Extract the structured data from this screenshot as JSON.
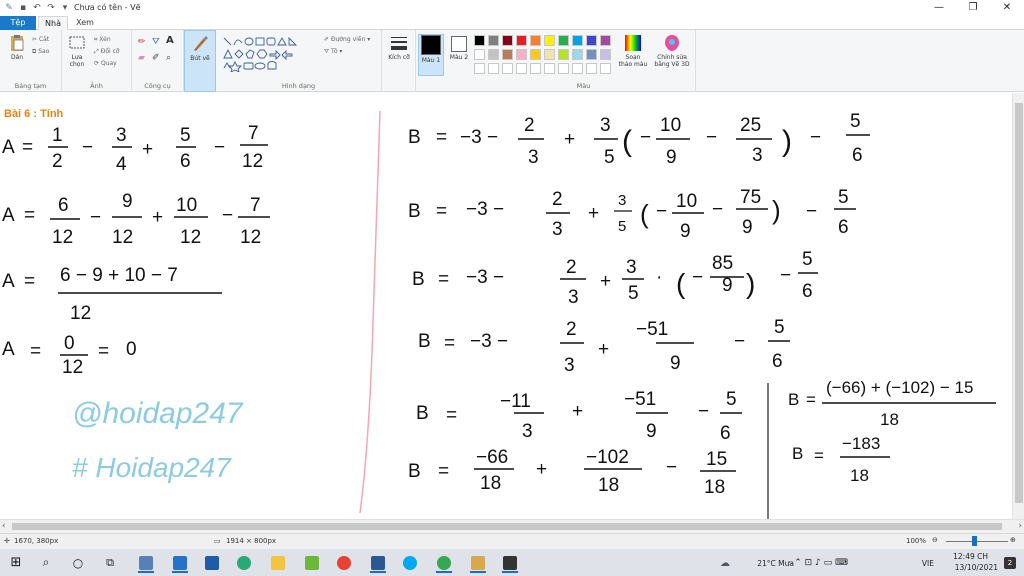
{
  "window": {
    "title": "Chưa có tên - Vẽ",
    "min": "—",
    "max": "❐",
    "close": "✕"
  },
  "tabs": [
    "Tệp",
    "Nhà",
    "Xem"
  ],
  "ribbon": {
    "groups": {
      "clipboard": "Bảng tạm",
      "image": "Ảnh",
      "tools": "Công cụ",
      "shapes": "Hình dạng",
      "colors": "Màu"
    },
    "paste": "Dán",
    "cut": "Cắt",
    "copy": "Sao",
    "select": "Lựa chọn",
    "crop": "Xén",
    "resize": "Đổi cỡ",
    "rotate": "Quay",
    "brush": "Bút vẽ",
    "outline": "Đường viền",
    "fill": "Tô",
    "size": "Kích cỡ",
    "color1": "Màu 1",
    "color2": "Màu 2",
    "edit_colors": "Soạn thảo màu",
    "paint3d": "Chỉnh sửa bằng Vẽ 3D",
    "palette": [
      "#000000",
      "#7f7f7f",
      "#880015",
      "#ed1c24",
      "#ff7f27",
      "#fff200",
      "#22b14c",
      "#00a2e8",
      "#3f48cc",
      "#a349a4",
      "#ffffff",
      "#c3c3c3",
      "#b97a57",
      "#ffaec9",
      "#ffc90e",
      "#efe4b0",
      "#b5e61d",
      "#99d9ea",
      "#7092be",
      "#c8bfe7"
    ]
  },
  "canvas": {
    "heading": "Bài 6 : Tính",
    "left": {
      "line1": [
        "A",
        "=",
        "1",
        "2",
        "−",
        "3",
        "4",
        "+",
        "5",
        "6",
        "−",
        "7",
        "12"
      ],
      "line2": [
        "A",
        "=",
        "6",
        "12",
        "−",
        "9",
        "12",
        "+",
        "10",
        "12",
        "−",
        "7",
        "12"
      ],
      "line3": [
        "A",
        "=",
        "6 − 9 + 10 − 7",
        "12"
      ],
      "line4": [
        "A",
        "=",
        "0",
        "12",
        "=",
        "0"
      ],
      "watermark1": "@hoidap247",
      "watermark2": "# Hoidap247"
    },
    "right": {
      "b1": [
        "B",
        "=",
        "−3 −",
        "2",
        "3",
        "+",
        "3",
        "5",
        "(",
        "−",
        "10",
        "9",
        "−",
        "25",
        "3",
        ")",
        "−",
        "5",
        "6"
      ],
      "b2": [
        "B",
        "=",
        "−3 −",
        "2",
        "3",
        "+",
        "3",
        "5",
        "(",
        "−",
        "10",
        "9",
        "−",
        "75",
        "9",
        ")",
        "−",
        "5",
        "6"
      ],
      "b3": [
        "B",
        "=",
        "−3 −",
        "2",
        "3",
        "+",
        "3",
        "5",
        "·",
        "(",
        "−",
        "85",
        "9",
        ")",
        "−",
        "5",
        "6"
      ],
      "b4": [
        "B",
        "=",
        "−3 −",
        "2",
        "3",
        "+",
        "−51",
        "9",
        "−",
        "5",
        "6"
      ],
      "b5": [
        "B",
        "=",
        "−11",
        "3",
        "+",
        "−51",
        "9",
        "−",
        "5",
        "6"
      ],
      "b6": [
        "B",
        "=",
        "−66",
        "18",
        "+",
        "−102",
        "18",
        "−",
        "15",
        "18"
      ],
      "c1": [
        "B",
        "=",
        "(−66) + (−102) − 15",
        "18"
      ],
      "c2": [
        "B",
        "=",
        "−183",
        "18"
      ]
    }
  },
  "status": {
    "cursor": "1670, 380px",
    "size": "1914 × 800px",
    "zoom": "100%"
  },
  "tray": {
    "weather": "21°C Mưa",
    "lang": "VIE",
    "time": "12:49 CH",
    "date": "13/10/2021",
    "notif": "2"
  }
}
